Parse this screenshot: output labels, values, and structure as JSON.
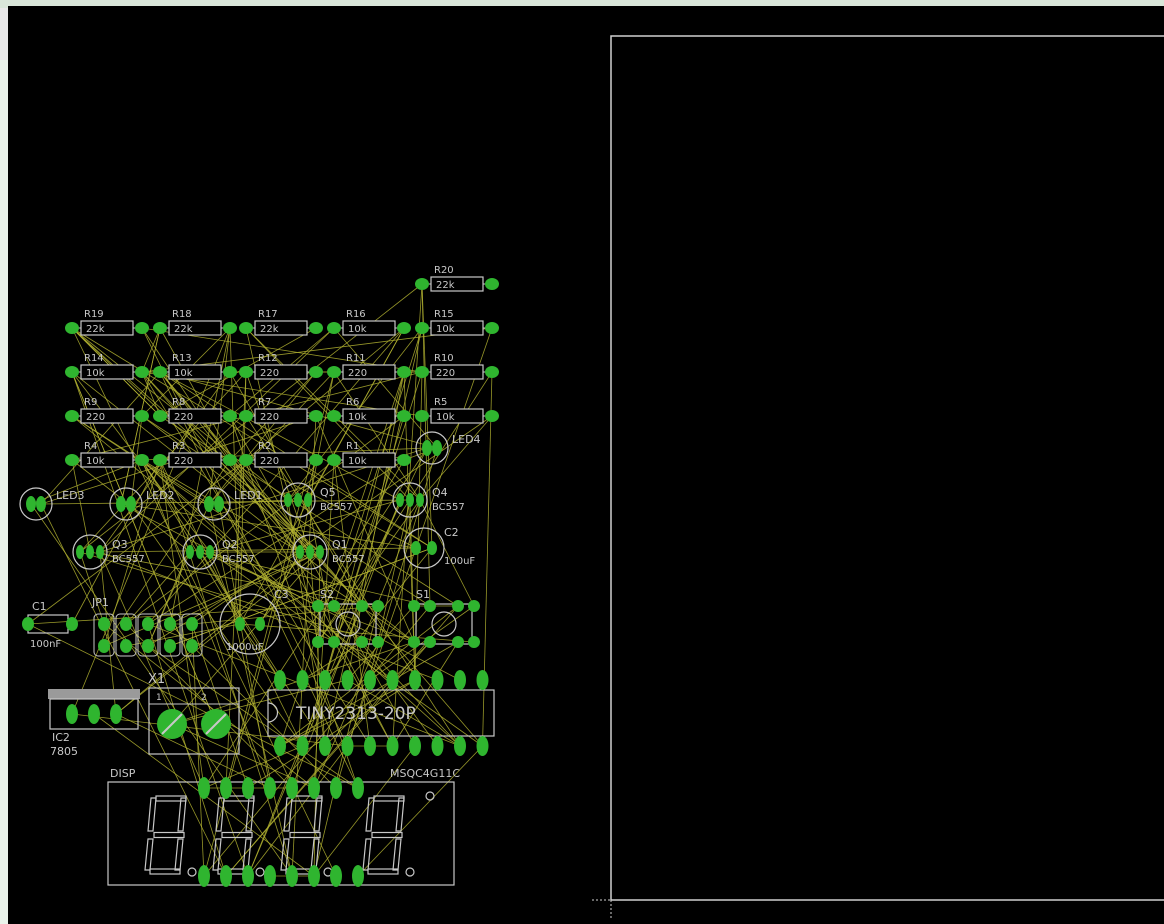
{
  "window": {
    "canvas_color": "#000000",
    "chrome_color": "#eaf3ea"
  },
  "colors": {
    "pad": "#2fb52f",
    "silk": "#c8c8c8",
    "airwire": "#b0b030",
    "frame": "#d0d0d0"
  },
  "resistors": [
    {
      "name": "R19",
      "value": "22k"
    },
    {
      "name": "R18",
      "value": "22k"
    },
    {
      "name": "R17",
      "value": "22k"
    },
    {
      "name": "R16",
      "value": "10k"
    },
    {
      "name": "R15",
      "value": "10k"
    },
    {
      "name": "R14",
      "value": "10k"
    },
    {
      "name": "R13",
      "value": "10k"
    },
    {
      "name": "R12",
      "value": "220"
    },
    {
      "name": "R11",
      "value": "220"
    },
    {
      "name": "R10",
      "value": "220"
    },
    {
      "name": "R9",
      "value": "220"
    },
    {
      "name": "R8",
      "value": "220"
    },
    {
      "name": "R7",
      "value": "220"
    },
    {
      "name": "R6",
      "value": "10k"
    },
    {
      "name": "R5",
      "value": "10k"
    },
    {
      "name": "R4",
      "value": "10k"
    },
    {
      "name": "R3",
      "value": "220"
    },
    {
      "name": "R2",
      "value": "220"
    },
    {
      "name": "R1",
      "value": "10k"
    },
    {
      "name": "R20",
      "value": "22k"
    }
  ],
  "leds": [
    "LED3",
    "LED2",
    "LED1",
    "LED4"
  ],
  "transistors": [
    {
      "name": "Q5",
      "value": "BC557"
    },
    {
      "name": "Q4",
      "value": "BC557"
    },
    {
      "name": "Q3",
      "value": "BC557"
    },
    {
      "name": "Q2",
      "value": "BC557"
    },
    {
      "name": "Q1",
      "value": "BC557"
    }
  ],
  "capacitors": [
    {
      "name": "C1",
      "value": "100nF"
    },
    {
      "name": "C2",
      "value": "100uF"
    },
    {
      "name": "C3",
      "value": "1000uF"
    }
  ],
  "connectors": {
    "jp1": "JP1",
    "x1": "X1",
    "x1_pins": [
      "1",
      "2"
    ]
  },
  "switches": [
    "S2",
    "S1"
  ],
  "regulator": {
    "name": "IC2",
    "value": "7805"
  },
  "mcu": {
    "name": "TINY2313-20P"
  },
  "display": {
    "name": "DISP",
    "value": "MSQC4G11C"
  }
}
